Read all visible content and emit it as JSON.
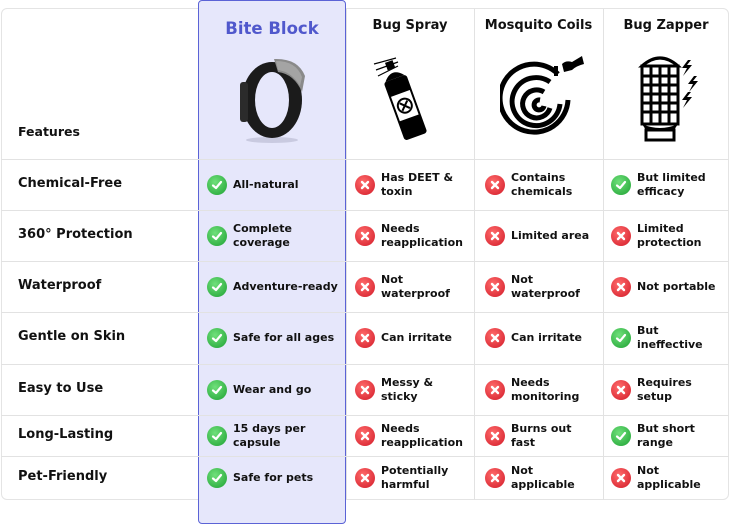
{
  "header": {
    "features_label": "Features",
    "columns": [
      {
        "name": "Bite Block",
        "icon": "wristband-image"
      },
      {
        "name": "Bug Spray",
        "icon": "spray-can-icon"
      },
      {
        "name": "Mosquito Coils",
        "icon": "mosquito-coil-icon"
      },
      {
        "name": "Bug Zapper",
        "icon": "bug-zapper-icon"
      }
    ]
  },
  "colors": {
    "accent": "#5058cc",
    "highlight_bg": "#e6e7fb",
    "check": "#1ea133",
    "cross": "#d21a28"
  },
  "rows": [
    {
      "feature": "Chemical-Free",
      "cells": [
        {
          "status": "check",
          "text": "All-natural"
        },
        {
          "status": "cross",
          "text": "Has DEET & toxin"
        },
        {
          "status": "cross",
          "text": "Contains chemicals"
        },
        {
          "status": "check",
          "text": "But limited efficacy"
        }
      ]
    },
    {
      "feature": "360° Protection",
      "cells": [
        {
          "status": "check",
          "text": "Complete coverage"
        },
        {
          "status": "cross",
          "text": "Needs reapplication"
        },
        {
          "status": "cross",
          "text": "Limited area"
        },
        {
          "status": "cross",
          "text": "Limited protection"
        }
      ]
    },
    {
      "feature": "Waterproof",
      "cells": [
        {
          "status": "check",
          "text": "Adventure-ready"
        },
        {
          "status": "cross",
          "text": "Not waterproof"
        },
        {
          "status": "cross",
          "text": "Not waterproof"
        },
        {
          "status": "cross",
          "text": "Not portable"
        }
      ]
    },
    {
      "feature": "Gentle on Skin",
      "cells": [
        {
          "status": "check",
          "text": "Safe for all ages"
        },
        {
          "status": "cross",
          "text": "Can irritate"
        },
        {
          "status": "cross",
          "text": "Can irritate"
        },
        {
          "status": "check",
          "text": "But ineffective"
        }
      ]
    },
    {
      "feature": "Easy to Use",
      "cells": [
        {
          "status": "check",
          "text": "Wear and go"
        },
        {
          "status": "cross",
          "text": "Messy & sticky"
        },
        {
          "status": "cross",
          "text": "Needs monitoring"
        },
        {
          "status": "cross",
          "text": "Requires setup"
        }
      ]
    },
    {
      "feature": "Long-Lasting",
      "cells": [
        {
          "status": "check",
          "text": "15 days per capsule"
        },
        {
          "status": "cross",
          "text": "Needs reapplication"
        },
        {
          "status": "cross",
          "text": "Burns out fast"
        },
        {
          "status": "check",
          "text": "But short range"
        }
      ]
    },
    {
      "feature": "Pet-Friendly",
      "cells": [
        {
          "status": "check",
          "text": "Safe for pets"
        },
        {
          "status": "cross",
          "text": "Potentially harmful"
        },
        {
          "status": "cross",
          "text": "Not applicable"
        },
        {
          "status": "cross",
          "text": "Not applicable"
        }
      ]
    }
  ]
}
